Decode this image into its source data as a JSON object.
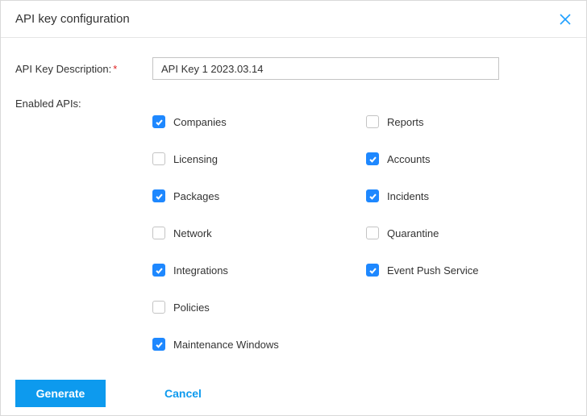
{
  "dialog": {
    "title": "API key configuration"
  },
  "form": {
    "description_label": "API Key Description:",
    "description_value": "API Key 1 2023.03.14",
    "enabled_apis_label": "Enabled APIs:"
  },
  "apis": {
    "col1": [
      {
        "label": "Companies",
        "checked": true
      },
      {
        "label": "Licensing",
        "checked": false
      },
      {
        "label": "Packages",
        "checked": true
      },
      {
        "label": "Network",
        "checked": false
      },
      {
        "label": "Integrations",
        "checked": true
      },
      {
        "label": "Policies",
        "checked": false
      },
      {
        "label": "Maintenance Windows",
        "checked": true
      }
    ],
    "col2": [
      {
        "label": "Reports",
        "checked": false
      },
      {
        "label": "Accounts",
        "checked": true
      },
      {
        "label": "Incidents",
        "checked": true
      },
      {
        "label": "Quarantine",
        "checked": false
      },
      {
        "label": "Event Push Service",
        "checked": true
      }
    ]
  },
  "footer": {
    "primary": "Generate",
    "secondary": "Cancel"
  }
}
